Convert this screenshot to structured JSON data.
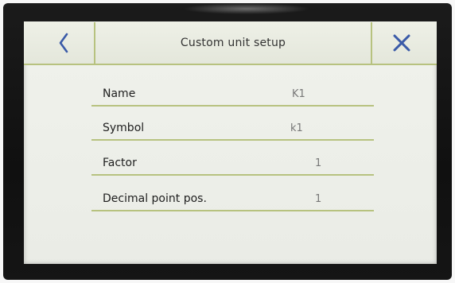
{
  "header": {
    "title": "Custom unit setup",
    "back_icon": "chevron-left-icon",
    "close_icon": "close-icon",
    "accent_color": "#3a5aa8",
    "divider_color": "#b7c27f"
  },
  "fields": [
    {
      "label": "Name",
      "value": "K1"
    },
    {
      "label": "Symbol",
      "value": "k1"
    },
    {
      "label": "Factor",
      "value": "1"
    },
    {
      "label": "Decimal point pos.",
      "value": "1"
    }
  ]
}
